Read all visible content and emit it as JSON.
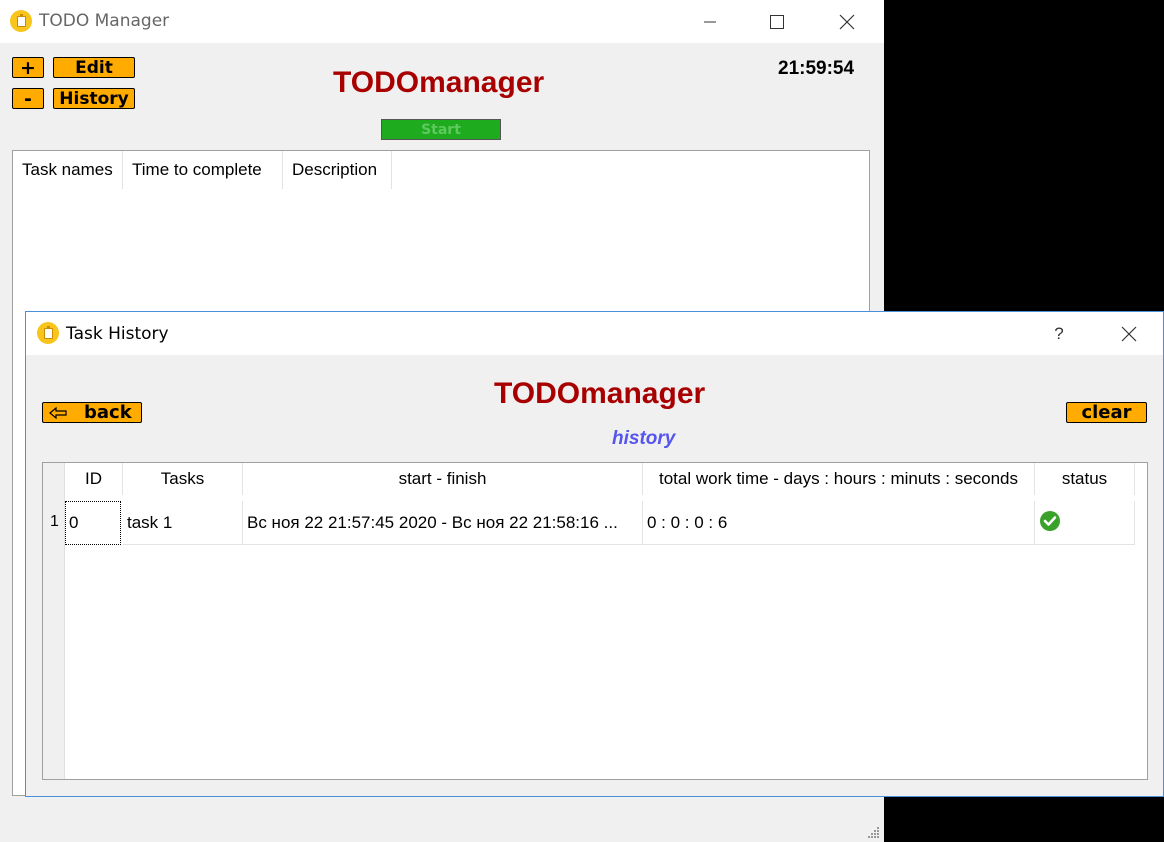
{
  "main_window": {
    "title": "TODO Manager",
    "buttons": {
      "add": "+",
      "remove": "-",
      "edit": "Edit",
      "history": "History",
      "start": "Start"
    },
    "brand": "TODOmanager",
    "clock": "21:59:54",
    "table_headers": [
      "Task names",
      "Time to complete",
      "Description"
    ]
  },
  "history_window": {
    "title": "Task History",
    "help": "?",
    "brand": "TODOmanager",
    "subtitle": "history",
    "back_label": "back",
    "clear_label": "clear",
    "columns": [
      "ID",
      "Tasks",
      "start - finish",
      "total work time - days : hours : minuts : seconds",
      "status"
    ],
    "rows": [
      {
        "row_number": "1",
        "id": "0",
        "task": "task 1",
        "start_finish": "Вс ноя 22 21:57:45 2020  -  Вс ноя 22 21:58:16 ...",
        "total_time": "0 : 0 : 0 : 6",
        "status": "done"
      }
    ]
  },
  "colors": {
    "accent_orange": "#ffab00",
    "brand_red": "#a80000",
    "start_green": "#1eab1e",
    "history_blue": "#5555ee",
    "status_green": "#3aa12b"
  },
  "icons": [
    "app-icon",
    "minimize-icon",
    "maximize-icon",
    "close-icon",
    "back-arrow-icon",
    "check-circle-icon",
    "resize-grip-icon"
  ]
}
